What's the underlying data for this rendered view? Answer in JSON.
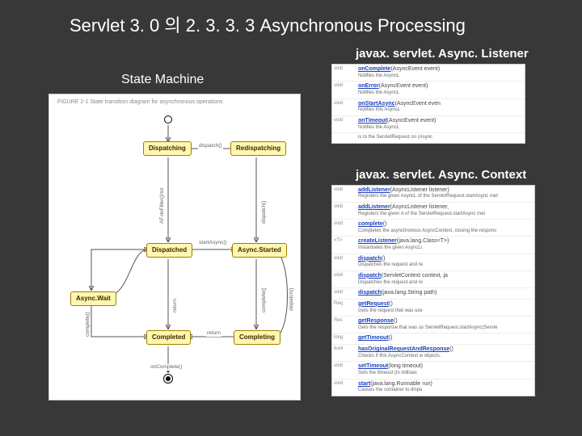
{
  "title": "Servlet 3. 0 의 2. 3. 3. 3 Asynchronous Processing",
  "left": {
    "subtitle": "State Machine",
    "caption": "FIGURE 2-1  State transition diagram for asynchronous operations",
    "states": {
      "dispatching": "Dispatching",
      "redispatching": "Redispatching",
      "dispatched": "Dispatched",
      "asyncStarted": "Async.Started",
      "asyncWait": "Async.Wait",
      "completed": "Completed",
      "completing": "Completing"
    },
    "edges": {
      "dispatch": "dispatch()",
      "afDispatched": "AF.doFilter()/sd",
      "dispatch2": "dispatch()",
      "startAsync": "startAsync()",
      "complete": "complete()",
      "ret": "return",
      "ret2": "return",
      "onComplete": "onComplete()",
      "complete2": "complete()",
      "dispatchUp": "dispatch()"
    }
  },
  "right": {
    "listenerTitle": "javax. servlet. Async. Listener",
    "listener": [
      {
        "rt": "void",
        "method": "onComplete",
        "args": "(AsyncEvent event)",
        "desc": "Notifies the AsyncL"
      },
      {
        "rt": "void",
        "method": "onError",
        "args": "(AsyncEvent event)",
        "desc": "Notifies the AsyncL"
      },
      {
        "rt": "void",
        "method": "onStartAsync",
        "args": "(AsyncEvent even",
        "desc": "Notifies this AsyncL"
      },
      {
        "rt": "void",
        "method": "onTimeout",
        "args": "(AsyncEvent event)",
        "desc": "Notifies the AsyncL"
      }
    ],
    "listenerExtra": "  is to the ServletRequest on (Async",
    "contextTitle": "javax. servlet. Async. Context",
    "context": [
      {
        "rt": "void",
        "method": "addListener",
        "args": "(AsyncListener listener)",
        "desc": "Registers the given AsyncL of the ServletRequest.startAsync met"
      },
      {
        "rt": "void",
        "method": "addListener",
        "args": "(AsyncListener listener,",
        "desc": "Registers the given A of the ServletRequest.startAsync met"
      },
      {
        "rt": "void",
        "method": "complete",
        "args": "()",
        "desc": "Completes the asynchronous AsyncContext, closing the respons"
      },
      {
        "rt": "<T>",
        "method": "createListener",
        "args": "(java.lang.Class<T>)",
        "desc": "Instantiates the given AsyncLi"
      },
      {
        "rt": "void",
        "method": "dispatch",
        "args": "()",
        "desc": "Dispatches the request and re"
      },
      {
        "rt": "void",
        "method": "dispatch",
        "args": "(ServletContext  context, ja",
        "desc": "Dispatches the request and re"
      },
      {
        "rt": "void",
        "method": "dispatch",
        "args": "(java.lang.String path)",
        "desc": ""
      },
      {
        "rt": "Req",
        "method": "getRequest",
        "args": "()",
        "desc": "Gets the request that was use"
      },
      {
        "rt": "Res",
        "method": "getResponse",
        "args": "()",
        "desc": "Gets the response that was us ServletRequest.startAsync(Servle"
      },
      {
        "rt": "long",
        "method": "getTimeout",
        "args": "()",
        "desc": ""
      },
      {
        "rt": "bool",
        "method": "hasOriginalRequestAndResponse",
        "args": "()",
        "desc": "Checks if this AsyncContext w objects."
      },
      {
        "rt": "void",
        "method": "setTimeout",
        "args": "(long timeout)",
        "desc": "Sets the timeout (in millisec"
      },
      {
        "rt": "void",
        "method": "start",
        "args": "(java.lang.Runnable run)",
        "desc": "Causes the container to dispa"
      }
    ]
  }
}
